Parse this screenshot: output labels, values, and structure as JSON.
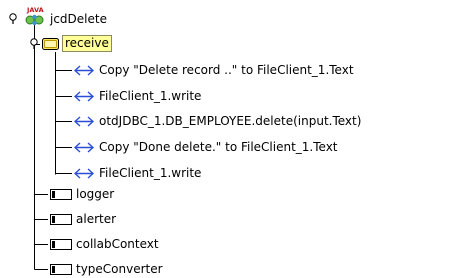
{
  "tree": {
    "root": {
      "label": "jcdDelete",
      "icon": "java-collaboration-icon",
      "expanded": true
    },
    "receive": {
      "label": "receive",
      "icon": "folder-icon",
      "expanded": true,
      "selected": true
    },
    "methods": [
      {
        "label": "Copy \"Delete record ..\" to FileClient_1.Text",
        "icon": "method-arrows-icon"
      },
      {
        "label": "FileClient_1.write",
        "icon": "method-arrows-icon"
      },
      {
        "label": "otdJDBC_1.DB_EMPLOYEE.delete(input.Text)",
        "icon": "method-arrows-icon"
      },
      {
        "label": "Copy \"Done delete.\" to FileClient_1.Text",
        "icon": "method-arrows-icon"
      },
      {
        "label": "FileClient_1.write",
        "icon": "method-arrows-icon"
      }
    ],
    "fields": [
      {
        "label": "logger",
        "icon": "field-icon"
      },
      {
        "label": "alerter",
        "icon": "field-icon"
      },
      {
        "label": "collabContext",
        "icon": "field-icon"
      },
      {
        "label": "typeConverter",
        "icon": "field-icon"
      }
    ]
  },
  "colors": {
    "method_arrow": "#2a4fd6",
    "folder_fill": "#ffe566",
    "selection_bg": "#ffff99",
    "tree_line": "#000000"
  }
}
